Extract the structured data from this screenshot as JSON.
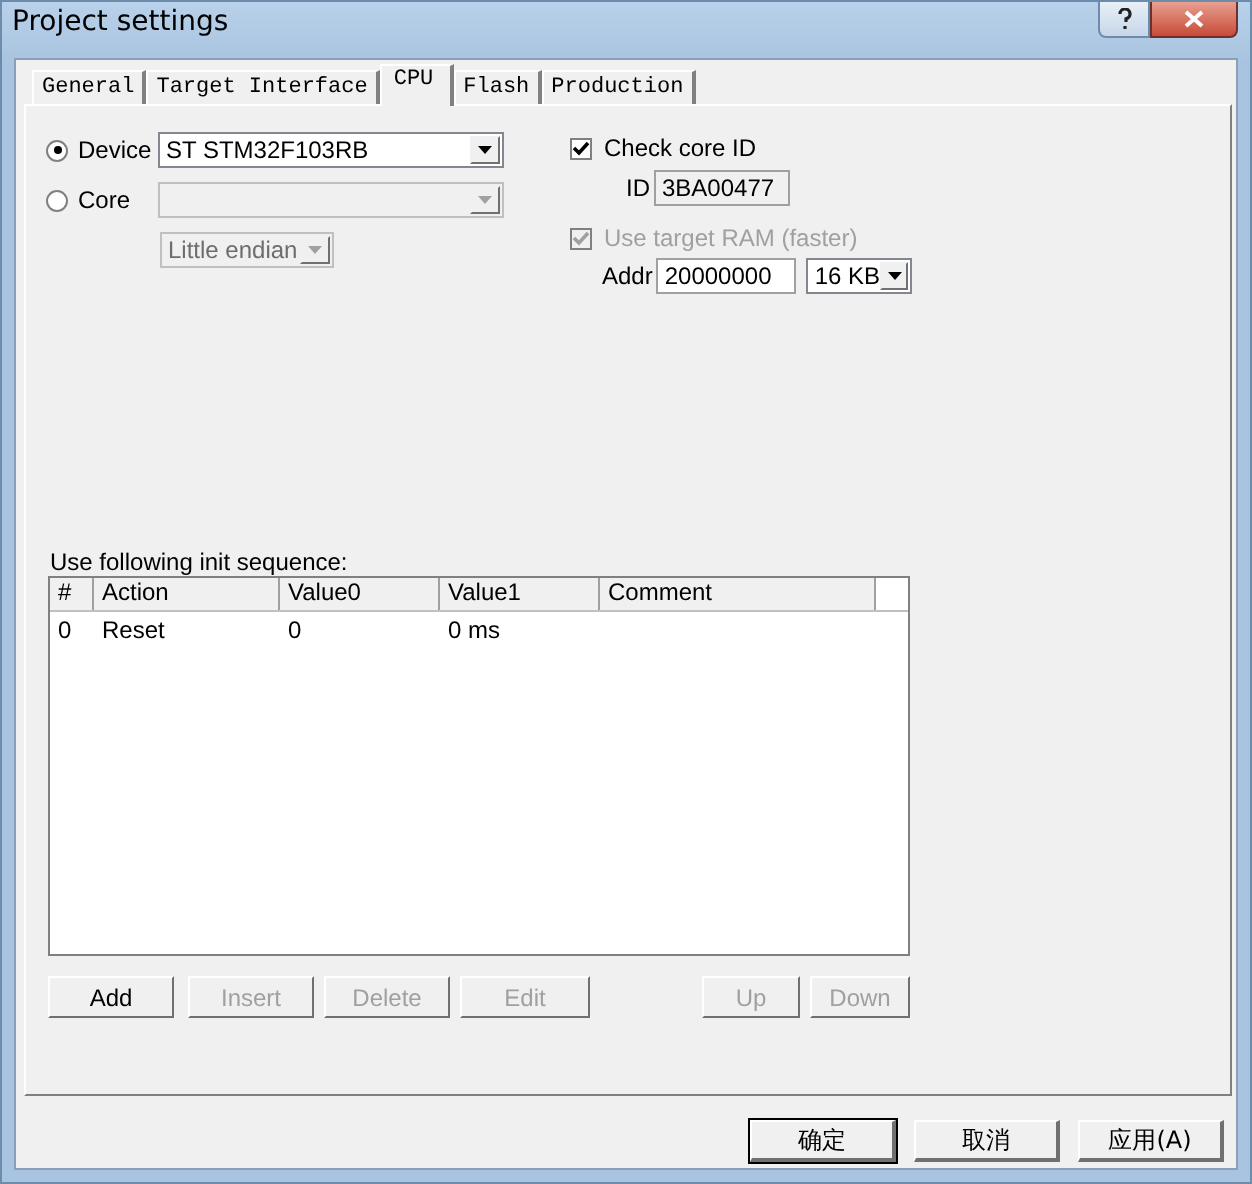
{
  "window": {
    "title": "Project settings"
  },
  "tabs": [
    {
      "label": "General",
      "selected": false
    },
    {
      "label": "Target Interface",
      "selected": false
    },
    {
      "label": "CPU",
      "selected": true
    },
    {
      "label": "Flash",
      "selected": false
    },
    {
      "label": "Production",
      "selected": false
    }
  ],
  "target": [
    {
      "label": "Device",
      "selected": true,
      "dropdown": {
        "value": "ST STM32F103RB",
        "disabled": false
      }
    },
    {
      "label": "Core",
      "selected": false,
      "dropdown": {
        "disabled": true
      }
    }
  ],
  "endian": {
    "value": "Little endian",
    "disabled": true
  },
  "check_core_id": {
    "label": "Check core ID",
    "checked": true,
    "disabled": false
  },
  "core_id": {
    "label": "ID",
    "value": "3BA00477"
  },
  "use_target_ram": {
    "label": "Use target RAM (faster)",
    "checked": true,
    "disabled": true
  },
  "addr": {
    "label": "Addr",
    "value": "20000000"
  },
  "ram_size": {
    "value": "16 KB",
    "disabled": false
  },
  "sequence": {
    "label": "Use following init sequence:",
    "columns": [
      "#",
      "Action",
      "Value0",
      "Value1",
      "Comment"
    ],
    "rows": [
      [
        "0",
        "Reset",
        "0",
        "0 ms",
        ""
      ]
    ],
    "buttons": [
      {
        "label": "Add",
        "disabled": false
      },
      {
        "label": "Insert",
        "disabled": true
      },
      {
        "label": "Delete",
        "disabled": true
      },
      {
        "label": "Edit",
        "disabled": true
      },
      {
        "label": "Up",
        "disabled": true
      },
      {
        "label": "Down",
        "disabled": true
      }
    ]
  },
  "dialog_buttons": [
    {
      "label": "确定",
      "default": true
    },
    {
      "label": "取消",
      "default": false
    },
    {
      "label": "应用(A)",
      "default": false
    }
  ]
}
